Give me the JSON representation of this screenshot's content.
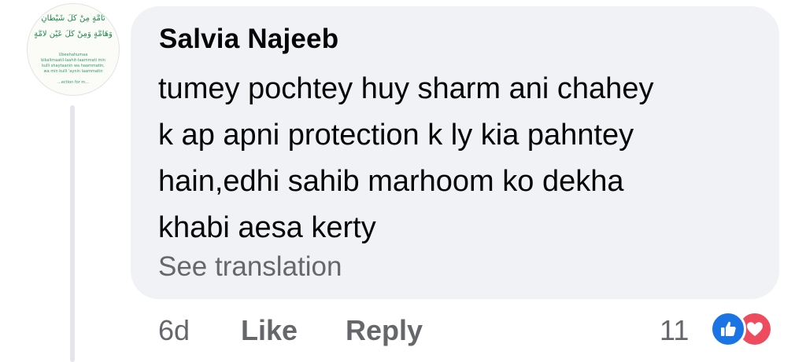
{
  "avatar": {
    "arabic_line_1": "تَامَّةٍ مِنْ كُلِّ شَيْطَانٍ",
    "arabic_line_2": "وَهَامَّةٍ وَمِنْ كُلِّ عَيْنٍ لَامَّةٍ",
    "translit_lines": [
      "Ubeehahumaa",
      "bikalimaatil-laahit-taammati min",
      "kulli shaytaanin wa haammatin,",
      "wa min kulli 'aynin laammatin",
      "",
      "...ection for m..."
    ]
  },
  "comment": {
    "author": "Salvia Najeeb",
    "lines": [
      "tumey pochtey huy sharm ani chahey",
      "k ap apni protection k ly kia pahntey",
      "hain,edhi sahib marhoom ko dekha",
      "khabi aesa kerty"
    ],
    "see_translation": "See translation"
  },
  "actions": {
    "time": "6d",
    "like": "Like",
    "reply": "Reply"
  },
  "reactions": {
    "count": "11",
    "types": [
      "like-icon",
      "love-icon"
    ]
  },
  "colors": {
    "bubble": "#f0f2f5",
    "secondary_text": "#65676b",
    "like_blue": "#1b74e4",
    "love_red": "#ee4b5f"
  }
}
